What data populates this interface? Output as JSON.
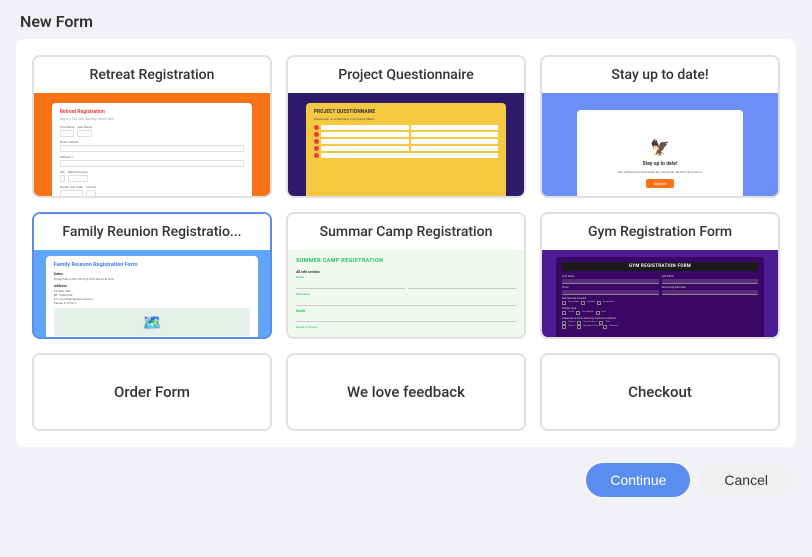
{
  "page": {
    "title": "New Form"
  },
  "cards": [
    {
      "id": "retreat-registration",
      "label": "Retreat Registration",
      "type": "preview",
      "selected": false
    },
    {
      "id": "project-questionnaire",
      "label": "Project Questionnaire",
      "type": "preview",
      "selected": false
    },
    {
      "id": "stay-up-to-date",
      "label": "Stay up to date!",
      "type": "preview",
      "selected": false
    },
    {
      "id": "family-reunion-registration",
      "label": "Family Reunion Registratio...",
      "type": "preview",
      "selected": true
    },
    {
      "id": "summer-camp-registration",
      "label": "Summar Camp Registration",
      "type": "preview",
      "selected": false
    },
    {
      "id": "gym-registration-form",
      "label": "Gym Registration Form",
      "type": "preview",
      "selected": false
    },
    {
      "id": "order-form",
      "label": "Order Form",
      "type": "text-only",
      "selected": false
    },
    {
      "id": "we-love-feedback",
      "label": "We love feedback",
      "type": "text-only",
      "selected": false
    },
    {
      "id": "checkout",
      "label": "Checkout",
      "type": "text-only",
      "selected": false
    }
  ],
  "buttons": {
    "continue": "Continue",
    "cancel": "Cancel"
  }
}
